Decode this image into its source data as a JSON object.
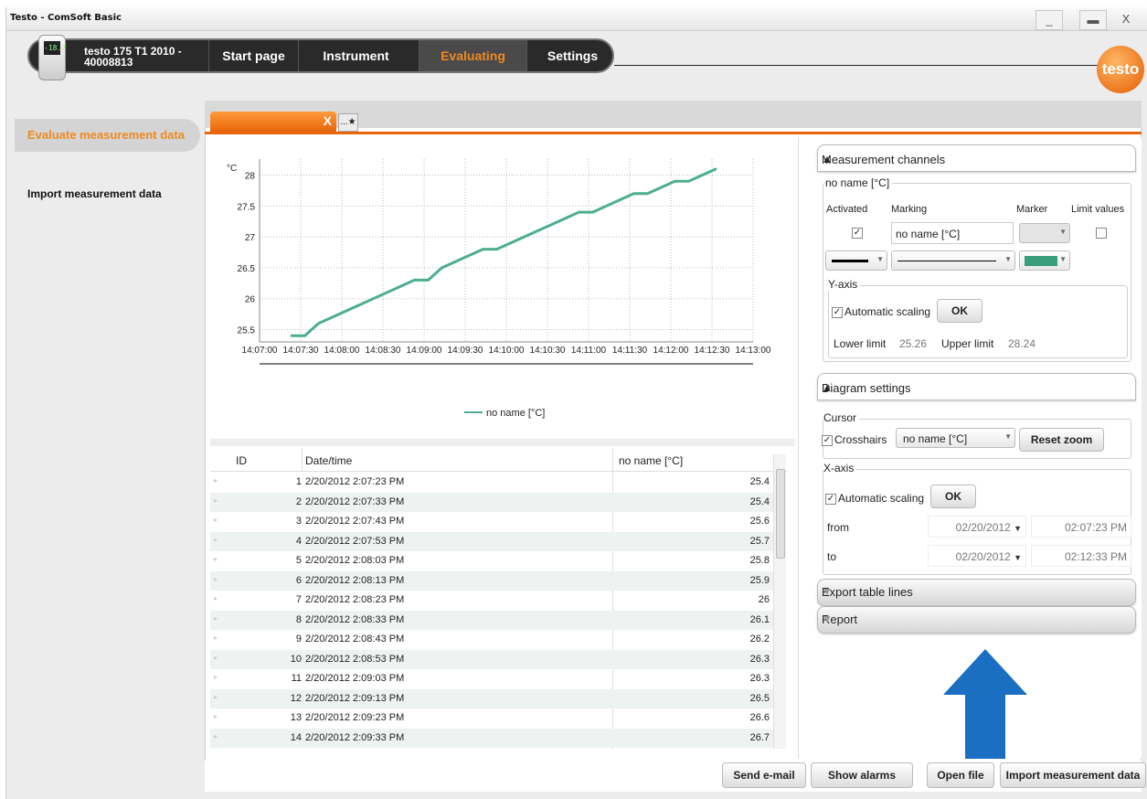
{
  "window": {
    "title": "Testo - ComSoft Basic",
    "controls": [
      "_",
      "▬",
      "X"
    ]
  },
  "device": {
    "name_line1": "testo 175 T1 2010 -",
    "name_line2": "40008813",
    "display": "-18.7"
  },
  "nav": {
    "tabs": [
      "Start page",
      "Instrument",
      "Evaluating",
      "Settings"
    ],
    "active": "Evaluating"
  },
  "logo": "testo",
  "sidebar": {
    "items": [
      "Evaluate measurement data",
      "Import measurement data"
    ]
  },
  "doc_tab": {
    "close": "X",
    "new": "...★"
  },
  "chart_data": {
    "type": "line",
    "ylabel": "°C",
    "x_ticks": [
      "14:07:00",
      "14:07:30",
      "14:08:00",
      "14:08:30",
      "14:09:00",
      "14:09:30",
      "14:10:00",
      "14:10:30",
      "14:11:00",
      "14:11:30",
      "14:12:00",
      "14:12:30",
      "14:13:00"
    ],
    "y_ticks": [
      "25.5",
      "26",
      "26.5",
      "27",
      "27.5",
      "28"
    ],
    "ylim": [
      25.3,
      28.2
    ],
    "xlim_seconds": [
      0,
      360
    ],
    "series": [
      {
        "name": "no name [°C]",
        "color": "#4caf8a",
        "x": [
          23,
          33,
          43,
          53,
          63,
          73,
          83,
          93,
          103,
          113,
          123,
          133,
          143,
          153,
          163,
          173,
          183,
          193,
          203,
          213,
          223,
          233,
          243,
          253,
          263,
          273,
          283,
          293,
          303,
          313,
          323,
          333
        ],
        "values": [
          25.4,
          25.4,
          25.6,
          25.7,
          25.8,
          25.9,
          26,
          26.1,
          26.2,
          26.3,
          26.3,
          26.5,
          26.6,
          26.7,
          26.8,
          26.8,
          26.9,
          27,
          27.1,
          27.2,
          27.3,
          27.4,
          27.4,
          27.5,
          27.6,
          27.7,
          27.7,
          27.8,
          27.9,
          27.9,
          28,
          28.1
        ]
      }
    ],
    "legend": "bottom-center",
    "grid": true
  },
  "table": {
    "headers": [
      "ID",
      "Date/time",
      "no name [°C]"
    ],
    "rows": [
      [
        "1",
        "2/20/2012 2:07:23 PM",
        "25.4"
      ],
      [
        "2",
        "2/20/2012 2:07:33 PM",
        "25.4"
      ],
      [
        "3",
        "2/20/2012 2:07:43 PM",
        "25.6"
      ],
      [
        "4",
        "2/20/2012 2:07:53 PM",
        "25.7"
      ],
      [
        "5",
        "2/20/2012 2:08:03 PM",
        "25.8"
      ],
      [
        "6",
        "2/20/2012 2:08:13 PM",
        "25.9"
      ],
      [
        "7",
        "2/20/2012 2:08:23 PM",
        "26"
      ],
      [
        "8",
        "2/20/2012 2:08:33 PM",
        "26.1"
      ],
      [
        "9",
        "2/20/2012 2:08:43 PM",
        "26.2"
      ],
      [
        "10",
        "2/20/2012 2:08:53 PM",
        "26.3"
      ],
      [
        "11",
        "2/20/2012 2:09:03 PM",
        "26.3"
      ],
      [
        "12",
        "2/20/2012 2:09:13 PM",
        "26.5"
      ],
      [
        "13",
        "2/20/2012 2:09:23 PM",
        "26.6"
      ],
      [
        "14",
        "2/20/2012 2:09:33 PM",
        "26.7"
      ]
    ]
  },
  "channels": {
    "title": "Measurement channels",
    "group": "no name [°C]",
    "activated_label": "Activated",
    "marking_label": "Marking",
    "marker_label": "Marker",
    "limit_label": "Limit values",
    "marking_value": "no name [°C]",
    "yaxis_label": "Y-axis",
    "auto_label": "Automatic scaling",
    "ok": "OK",
    "lower_label": "Lower limit",
    "lower_value": "25.26",
    "upper_label": "Upper limit",
    "upper_value": "28.24",
    "line_color": "#3a9d7b"
  },
  "diagram": {
    "title": "Diagram settings",
    "cursor_label": "Cursor",
    "crosshairs_label": "Crosshairs",
    "crosshairs_value": "no name [°C]",
    "reset": "Reset zoom",
    "xaxis_label": "X-axis",
    "auto_label": "Automatic scaling",
    "ok": "OK",
    "from_label": "from",
    "from_date": "02/20/2012",
    "from_time": "02:07:23 PM",
    "to_label": "to",
    "to_date": "02/20/2012",
    "to_time": "02:12:33 PM"
  },
  "export": {
    "title": "Export table lines"
  },
  "report": {
    "title": "Report"
  },
  "bottom": {
    "send": "Send e-mail",
    "alarms": "Show alarms",
    "open": "Open file",
    "import": "Import measurement data"
  },
  "accent": "#e8650b"
}
